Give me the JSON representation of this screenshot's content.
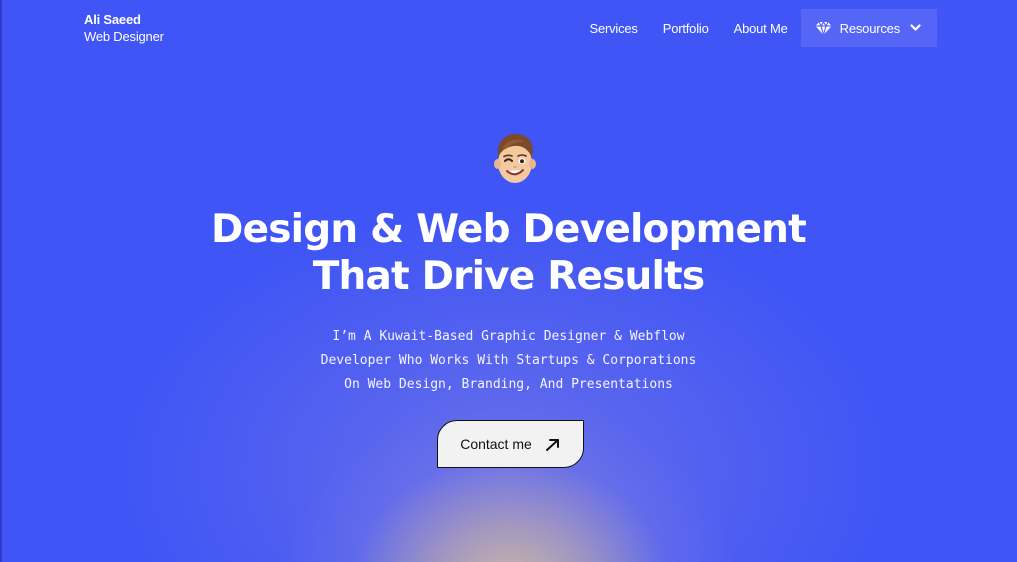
{
  "brand": {
    "name": "Ali Saeed",
    "role": "Web Designer"
  },
  "nav": {
    "items": [
      {
        "label": "Services"
      },
      {
        "label": "Portfolio"
      },
      {
        "label": "About Me"
      }
    ],
    "resources_label": "Resources",
    "resources_icon": "diamond-icon"
  },
  "hero": {
    "headline_line1": "Design & Web Development",
    "headline_line2": "That Drive Results",
    "subtitle_line1": "I’m A Kuwait-Based Graphic Designer & Webflow",
    "subtitle_line2": "Developer Who Works With Startups & Corporations",
    "subtitle_line3": "On Web Design, Branding, And Presentations",
    "cta_label": "Contact me",
    "cta_icon": "arrow-up-right-icon",
    "avatar_icon": "memoji-wink-avatar"
  },
  "colors": {
    "background": "#3f55f5",
    "nav_highlight": "#5566f7",
    "cta_background": "#f2f2f2",
    "text": "#ffffff"
  }
}
